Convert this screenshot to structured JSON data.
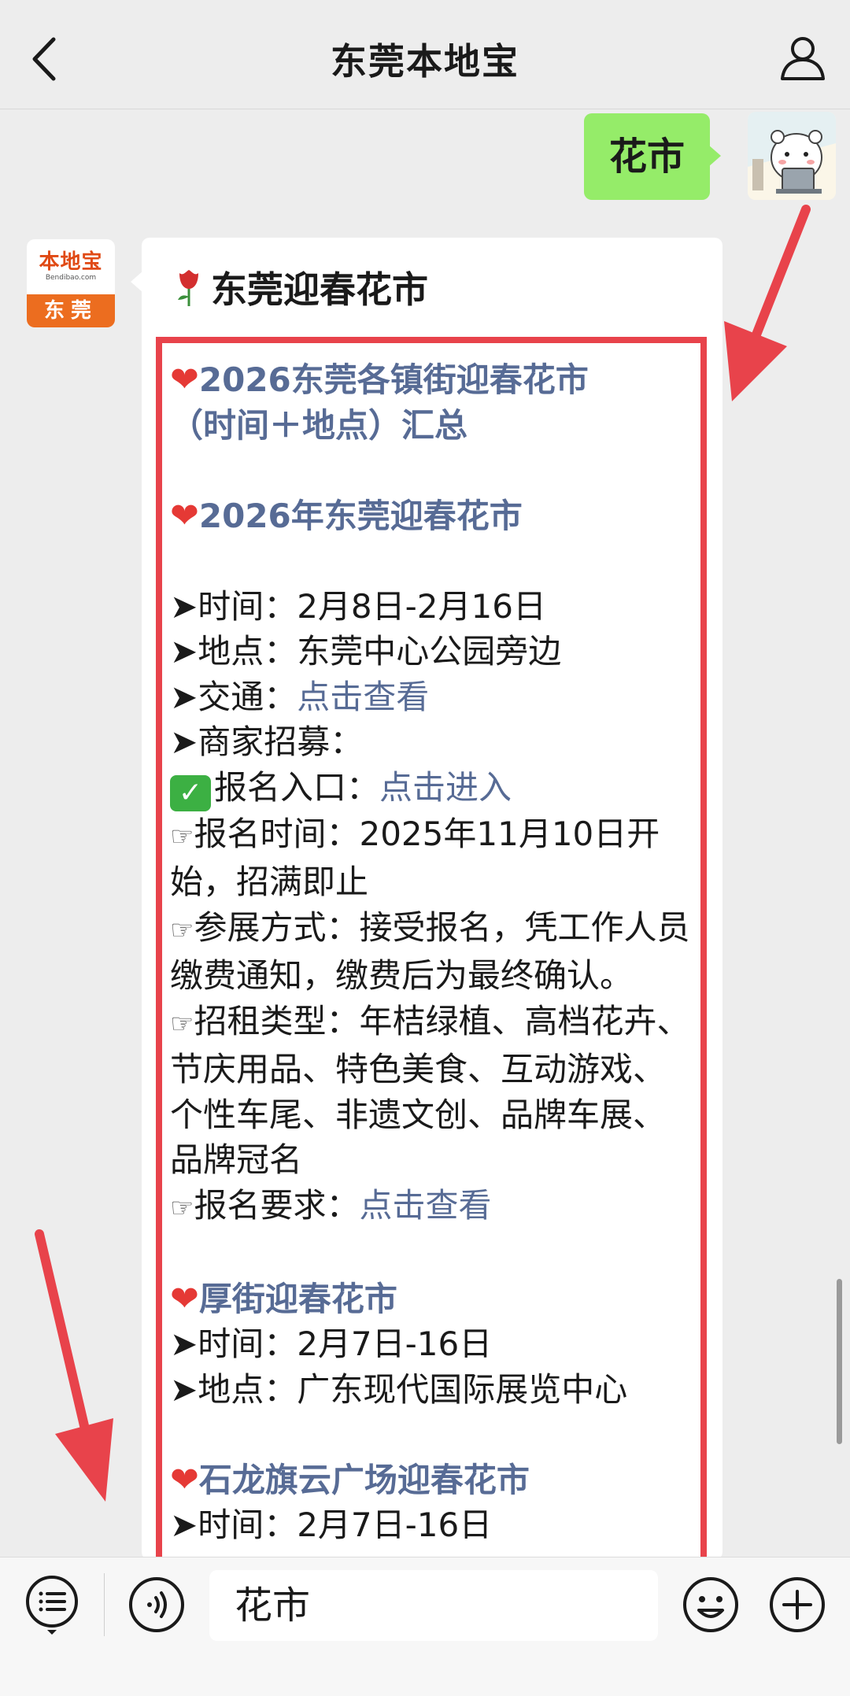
{
  "header": {
    "title": "东莞本地宝",
    "back_icon": "chevron-left-icon",
    "profile_icon": "person-icon"
  },
  "user_message": {
    "text": "花市"
  },
  "bot_message": {
    "avatar": {
      "logo_text": "本地宝",
      "logo_sub": "Bendibao.com",
      "city": "东莞"
    },
    "title": "东莞迎春花市",
    "title_icon": "rose-icon",
    "content": {
      "heading1_line1": "2026东莞各镇街迎春花市",
      "heading1_line2": "（时间＋地点）汇总",
      "heading2": "2026年东莞迎春花市",
      "time": "➤时间：2月8日-2月16日",
      "place": "➤地点：东莞中心公园旁边",
      "transport_label": "➤交通：",
      "transport_link": "点击查看",
      "merchant": "➤商家招募：",
      "signup_label": "报名入口：",
      "signup_link": "点击进入",
      "signup_time": "报名时间：2025年11月10日开始，招满即止",
      "method": "参展方式：接受报名，凭工作人员缴费通知，缴费后为最终确认。",
      "types": "招租类型：年桔绿植、高档花卉、节庆用品、特色美食、互动游戏、个性车尾、非遗文创、品牌车展、品牌冠名",
      "require_label": "报名要求：",
      "require_link": "点击查看",
      "heading3": "厚街迎春花市",
      "time2": "➤时间：2月7日-16日",
      "place2": "➤地点：广东现代国际展览中心",
      "heading4": "石龙旗云广场迎春花市",
      "time3": "➤时间：2月7日-16日"
    }
  },
  "input_bar": {
    "value": "花市",
    "menu_icon": "list-menu-icon",
    "voice_icon": "voice-icon",
    "emoji_icon": "smiley-icon",
    "plus_icon": "plus-circle-icon"
  },
  "colors": {
    "highlight": "#e8434b",
    "link": "#576b95",
    "user_bubble": "#95ec69"
  }
}
